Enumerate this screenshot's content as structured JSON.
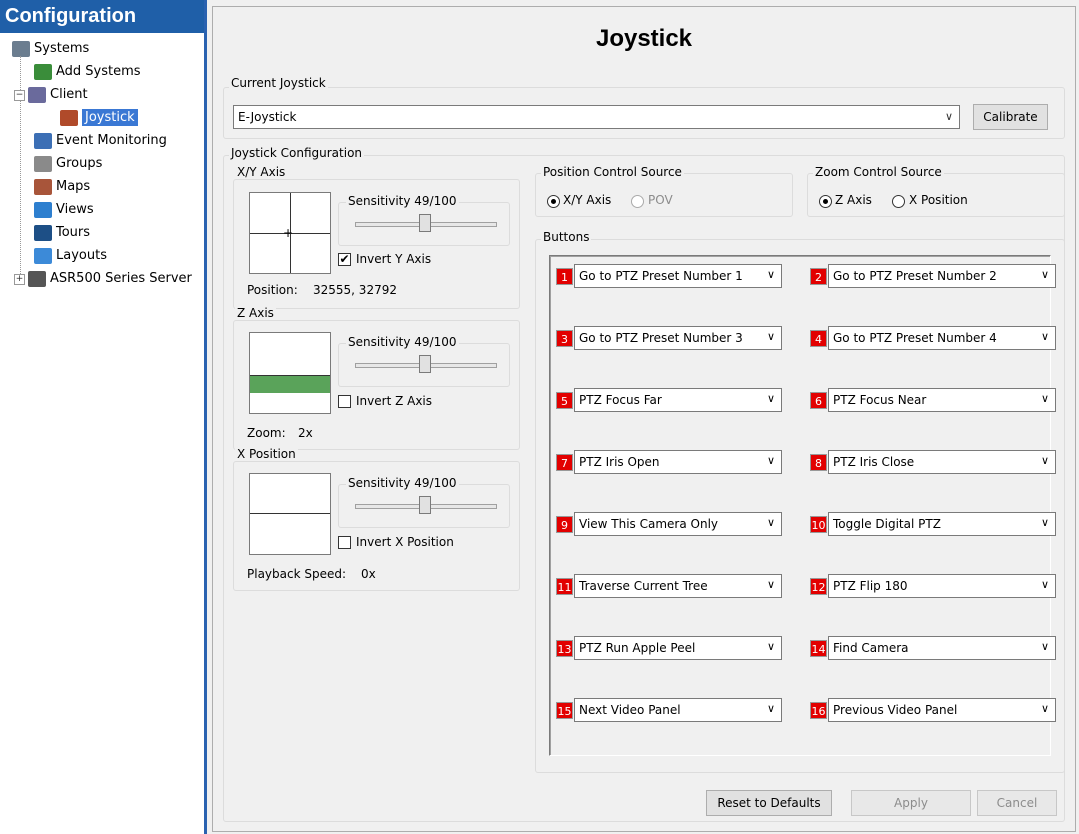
{
  "sidebar": {
    "title": "Configuration",
    "items": [
      {
        "label": "Systems",
        "icon": "server-icon"
      },
      {
        "label": "Add Systems",
        "icon": "add-system-icon"
      },
      {
        "label": "Client",
        "icon": "gear-icon"
      },
      {
        "label": "Joystick",
        "icon": "joystick-icon"
      },
      {
        "label": "Event Monitoring",
        "icon": "event-icon"
      },
      {
        "label": "Groups",
        "icon": "groups-icon"
      },
      {
        "label": "Maps",
        "icon": "map-icon"
      },
      {
        "label": "Views",
        "icon": "views-icon"
      },
      {
        "label": "Tours",
        "icon": "tours-icon"
      },
      {
        "label": "Layouts",
        "icon": "layouts-icon"
      },
      {
        "label": "ASR500 Series Server",
        "icon": "server-gear-icon"
      }
    ],
    "selected": "Joystick"
  },
  "page": {
    "title": "Joystick",
    "current_joystick_label": "Current Joystick",
    "current_joystick_value": "E-Joystick",
    "calibrate_label": "Calibrate",
    "config_label": "Joystick Configuration"
  },
  "xy_axis": {
    "label": "X/Y Axis",
    "sensitivity": "Sensitivity 49/100",
    "sensitivity_value": 49,
    "invert_label": "Invert Y Axis",
    "invert_checked": true,
    "position_label": "Position:",
    "position_value": "32555, 32792"
  },
  "z_axis": {
    "label": "Z Axis",
    "sensitivity": "Sensitivity 49/100",
    "sensitivity_value": 49,
    "invert_label": "Invert Z Axis",
    "invert_checked": false,
    "zoom_label": "Zoom:",
    "zoom_value": "2x"
  },
  "x_position": {
    "label": "X Position",
    "sensitivity": "Sensitivity 49/100",
    "sensitivity_value": 49,
    "invert_label": "Invert X Position",
    "invert_checked": false,
    "playback_label": "Playback Speed:",
    "playback_value": "0x"
  },
  "position_control": {
    "label": "Position Control Source",
    "options": [
      "X/Y Axis",
      "POV"
    ],
    "selected": "X/Y Axis"
  },
  "zoom_control": {
    "label": "Zoom Control Source",
    "options": [
      "Z Axis",
      "X Position"
    ],
    "selected": "Z Axis"
  },
  "buttons": {
    "label": "Buttons",
    "items": [
      {
        "num": "1",
        "action": "Go to PTZ Preset Number 1"
      },
      {
        "num": "2",
        "action": "Go to PTZ Preset Number 2"
      },
      {
        "num": "3",
        "action": "Go to PTZ Preset Number 3"
      },
      {
        "num": "4",
        "action": "Go to PTZ Preset Number 4"
      },
      {
        "num": "5",
        "action": "PTZ Focus Far"
      },
      {
        "num": "6",
        "action": "PTZ Focus Near"
      },
      {
        "num": "7",
        "action": "PTZ Iris Open"
      },
      {
        "num": "8",
        "action": "PTZ Iris Close"
      },
      {
        "num": "9",
        "action": "View This Camera Only"
      },
      {
        "num": "10",
        "action": "Toggle Digital PTZ"
      },
      {
        "num": "11",
        "action": "Traverse Current Tree"
      },
      {
        "num": "12",
        "action": "PTZ Flip 180"
      },
      {
        "num": "13",
        "action": "PTZ Run Apple Peel"
      },
      {
        "num": "14",
        "action": "Find Camera"
      },
      {
        "num": "15",
        "action": "Next Video Panel"
      },
      {
        "num": "16",
        "action": "Previous Video Panel"
      }
    ]
  },
  "footer": {
    "reset_label": "Reset to Defaults",
    "apply_label": "Apply",
    "cancel_label": "Cancel"
  },
  "colors": {
    "accent": "#1f5fa8",
    "selection": "#3a78d4",
    "button_number": "#e20000",
    "zoom_bar": "#5aa35a"
  }
}
